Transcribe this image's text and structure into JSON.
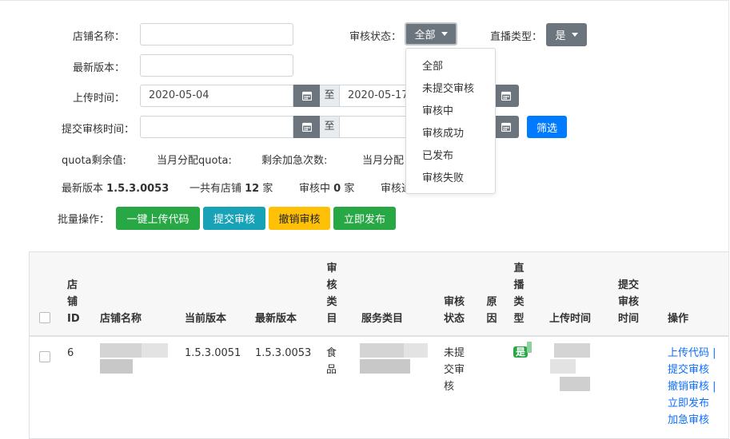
{
  "filters": {
    "shop_name_label": "店铺名称：",
    "shop_name_value": "",
    "latest_version_label": "最新版本：",
    "latest_version_value": "",
    "upload_time_label": "上传时间：",
    "upload_time_from": "2020-05-04",
    "upload_time_sep": "至",
    "upload_time_to": "2020-05-17",
    "submit_time_label": "提交审核时间：",
    "submit_time_from": "",
    "submit_time_sep": "至",
    "submit_time_to": "",
    "audit_status_label": "审核状态：",
    "audit_status_selected": "全部",
    "live_type_label": "直播类型：",
    "live_type_selected": "是",
    "filter_button": "筛选"
  },
  "audit_status_menu": {
    "options": [
      "全部",
      "未提交审核",
      "审核中",
      "审核成功",
      "已发布",
      "审核失败"
    ]
  },
  "quota": {
    "remaining": "quota剩余值:",
    "monthly": "当月分配quota:",
    "urgent_left": "剩余加急次数:",
    "monthly_urgent": "当月分配"
  },
  "stats": {
    "latest_version_prefix": "最新版本 ",
    "latest_version": "1.5.3.0053",
    "total_prefix": "一共有店铺 ",
    "total": "12",
    "total_suffix": " 家",
    "auditing_prefix": "审核中 ",
    "auditing": "0",
    "auditing_suffix": " 家",
    "more_prefix": "审核通"
  },
  "batch": {
    "label": "批量操作：",
    "upload_code": "一键上传代码",
    "submit_audit": "提交审核",
    "cancel_audit": "撤销审核",
    "publish_now": "立即发布"
  },
  "table": {
    "headers": {
      "shop_id": [
        "店",
        "铺",
        "ID"
      ],
      "shop_name": "店铺名称",
      "current_version": "当前版本",
      "latest_version": "最新版本",
      "audit_category": [
        "审",
        "核",
        "类",
        "目"
      ],
      "service_category": "服务类目",
      "audit_status": [
        "审核",
        "状态"
      ],
      "reason": [
        "原",
        "因"
      ],
      "live_type": [
        "直",
        "播",
        "类",
        "型"
      ],
      "upload_time": "上传时间",
      "submit_time": [
        "提交",
        "审核",
        "时间"
      ],
      "actions": "操作"
    },
    "rows": [
      {
        "shop_id": "6",
        "current_version": "1.5.3.0051",
        "latest_version": "1.5.3.0053",
        "audit_category": [
          "食",
          "品"
        ],
        "audit_status": [
          "未提",
          "交审",
          "核"
        ],
        "live_type": "是",
        "actions": [
          "上传代码 |",
          "提交审核",
          "撤销审核 |",
          "立即发布",
          "加急审核"
        ]
      }
    ]
  },
  "colors": {
    "primary": "#007bff",
    "success": "#28a745",
    "info": "#17a2b8",
    "warning": "#ffc107",
    "secondary": "#6c757d",
    "link": "#0d6efd"
  }
}
